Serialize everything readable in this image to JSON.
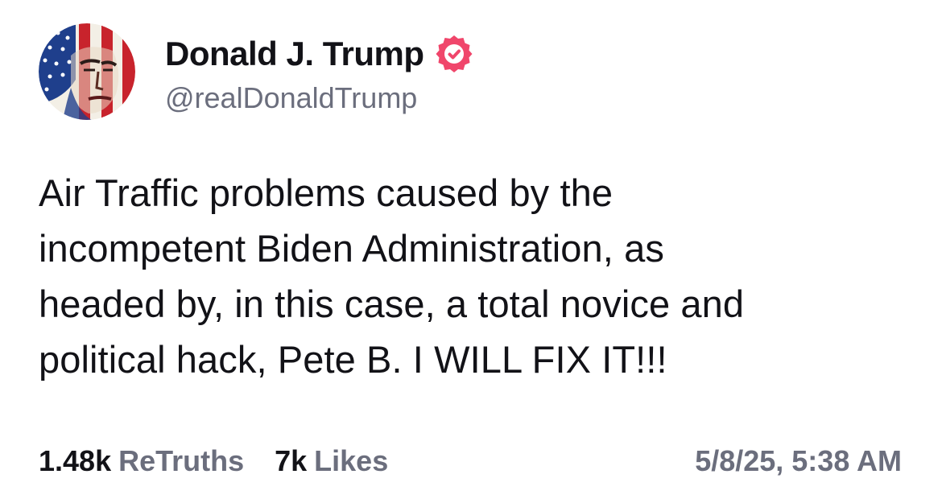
{
  "author": {
    "name": "Donald J. Trump",
    "handle": "@realDonaldTrump",
    "avatar_icon": "flag-portrait-avatar",
    "verified_icon": "verified-badge-icon",
    "verified_color": "#f0466b"
  },
  "post": {
    "text_lines": [
      "Air Traffic problems caused by the",
      "incompetent Biden Administration, as",
      "headed by, in this case, a total novice and",
      "political hack, Pete B. I WILL FIX IT!!!"
    ]
  },
  "stats": {
    "retruths_count": "1.48k",
    "retruths_label": "ReTruths",
    "likes_count": "7k",
    "likes_label": "Likes"
  },
  "timestamp": "5/8/25, 5:38 AM",
  "colors": {
    "text_primary": "#121217",
    "text_secondary": "#6b6e7d",
    "background": "#ffffff"
  }
}
